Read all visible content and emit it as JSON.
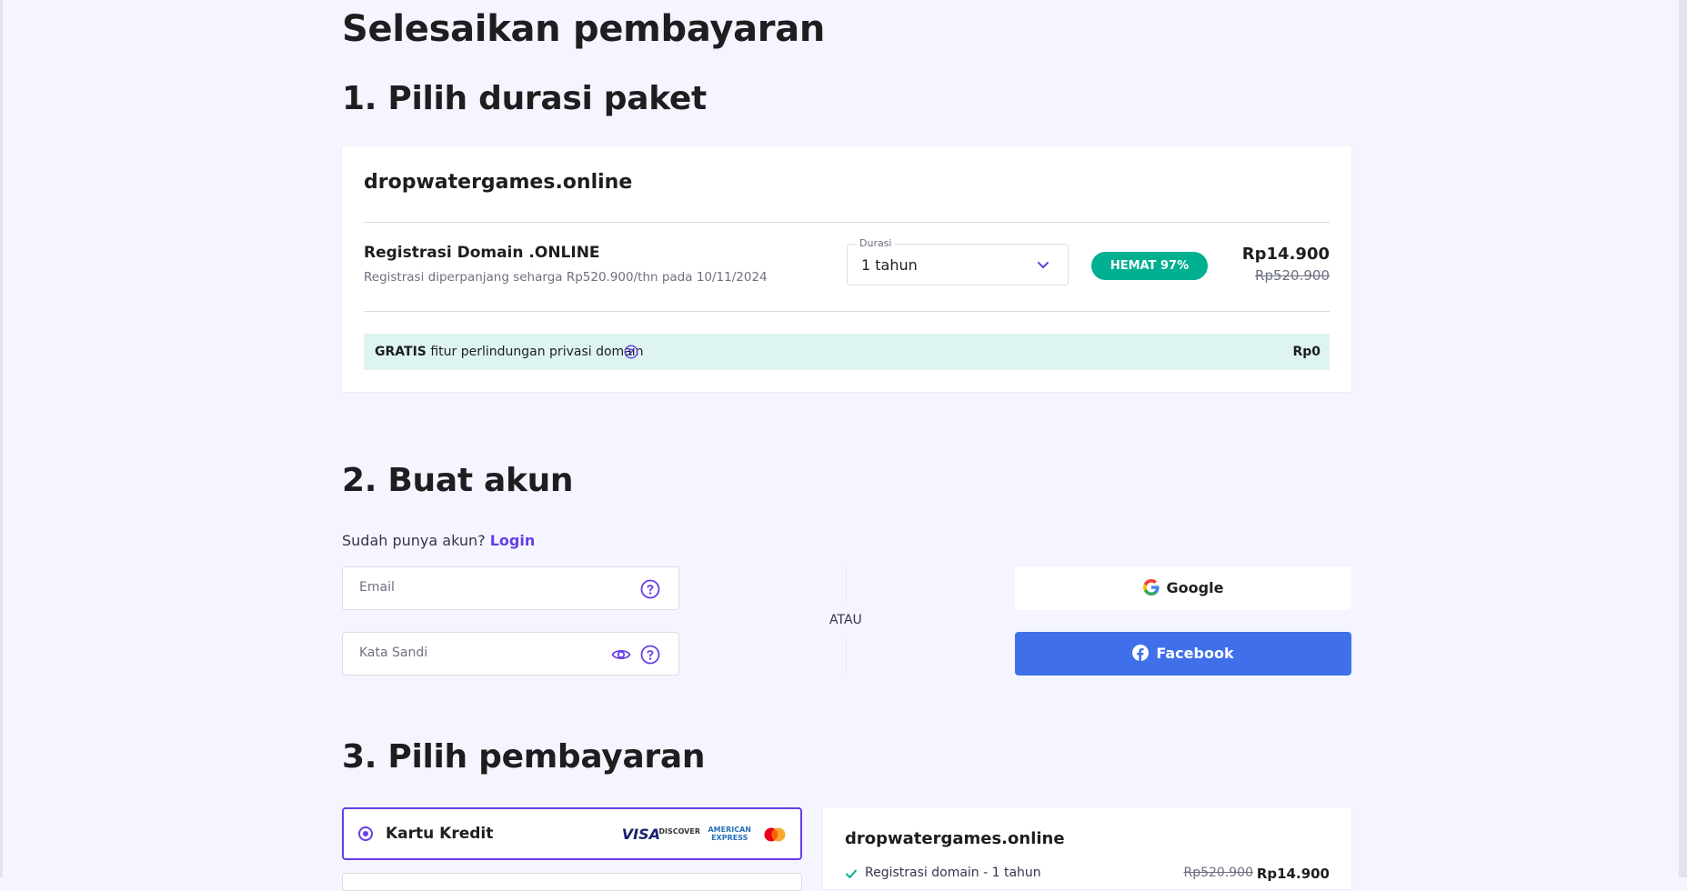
{
  "page": {
    "title": "Selesaikan pembayaran"
  },
  "section1": {
    "title": "1. Pilih durasi paket",
    "domain": "dropwatergames.online",
    "item_title": "Registrasi Domain .ONLINE",
    "item_sub": "Registrasi diperpanjang seharga Rp520.900/thn pada 10/11/2024",
    "duration_label": "Durasi",
    "duration_value": "1 tahun",
    "badge": "HEMAT 97%",
    "price_now": "Rp14.900",
    "price_old": "Rp520.900",
    "privacy_free": "GRATIS",
    "privacy_text": "fitur perlindungan privasi domain",
    "privacy_price": "Rp0"
  },
  "section2": {
    "title": "2. Buat akun",
    "have_account": "Sudah punya akun?",
    "login_link": "Login",
    "email_placeholder": "Email",
    "password_placeholder": "Kata Sandi",
    "or": "ATAU",
    "google_label": "Google",
    "facebook_label": "Facebook"
  },
  "section3": {
    "title": "3. Pilih pembayaran",
    "option_label": "Kartu Kredit",
    "logos": {
      "visa": "VISA",
      "discover": "DISCOVER",
      "amex_line1": "AMERICAN",
      "amex_line2": "EXPRESS"
    },
    "summary": {
      "domain": "dropwatergames.online",
      "item": "Registrasi domain - 1 tahun",
      "old_price": "Rp520.900",
      "new_price": "Rp14.900"
    }
  },
  "colors": {
    "accent": "#673de6",
    "badge": "#00b090",
    "facebook": "#3f70ea",
    "background": "#f4f5ff",
    "privacy_row": "#def4f0"
  }
}
